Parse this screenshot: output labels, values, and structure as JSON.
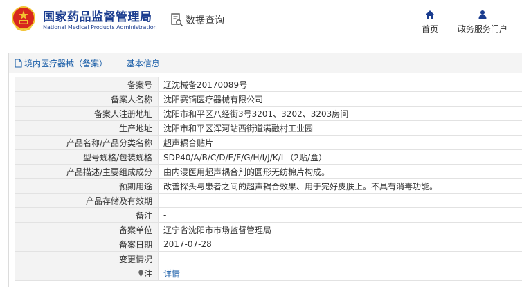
{
  "header": {
    "logo_cn": "国家药品监督管理局",
    "logo_en": "National Medical Products Administration",
    "query_label": "数据查询",
    "nav": [
      {
        "label": "首页",
        "icon": "home-icon"
      },
      {
        "label": "政务服务门户",
        "icon": "user-icon"
      }
    ]
  },
  "panel": {
    "title": "境内医疗器械（备案） ——基本信息",
    "rows": [
      {
        "key": "备案号",
        "value": "辽沈械备20170089号"
      },
      {
        "key": "备案人名称",
        "value": "沈阳赛镝医疗器械有限公司"
      },
      {
        "key": "备案人注册地址",
        "value": "沈阳市和平区八经街3号3201、3202、3203房间"
      },
      {
        "key": "生产地址",
        "value": "沈阳市和平区浑河站西街道满融村工业园"
      },
      {
        "key": "产品名称/产品分类名称",
        "value": "超声耦合贴片"
      },
      {
        "key": "型号规格/包装规格",
        "value": "SDP40/A/B/C/D/E/F/G/H/I/J/K/L（2贴/盒）"
      },
      {
        "key": "产品描述/主要组成成分",
        "value": "由内浸医用超声耦合剂的圆形无纺棉片构成。"
      },
      {
        "key": "预期用途",
        "value": "改善探头与患者之间的超声耦合效果、用于完好皮肤上。不具有消毒功能。"
      },
      {
        "key": "产品存储及有效期",
        "value": ""
      },
      {
        "key": "备注",
        "value": "-"
      },
      {
        "key": "备案单位",
        "value": "辽宁省沈阳市市场监督管理局"
      },
      {
        "key": "备案日期",
        "value": "2017-07-28"
      },
      {
        "key": "变更情况",
        "value": "-"
      }
    ],
    "note_key": "注",
    "note_value": "详情"
  },
  "colors": {
    "brand_blue": "#1a3c8f",
    "link_blue": "#1a5ea8",
    "emblem_red": "#d7261e",
    "emblem_gold": "#f2c230"
  }
}
